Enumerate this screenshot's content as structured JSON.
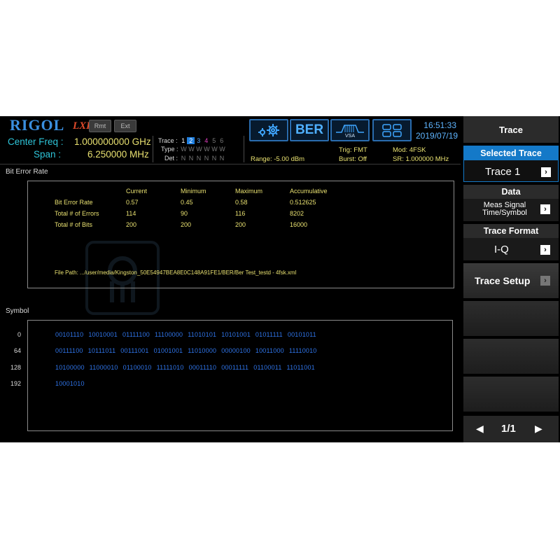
{
  "header": {
    "brand": "RIGOL",
    "lxi": "LXI",
    "rmt_label": "Rmt",
    "ext_label": "Ext",
    "center_freq_label": "Center Freq :",
    "center_freq_value": "1.000000000 GHz",
    "span_label": "Span :",
    "span_value": "6.250000 MHz",
    "trace_label": "Trace :",
    "type_label": "Type :",
    "det_label": "Det :",
    "trace_numbers": [
      "1",
      "2",
      "3",
      "4",
      "5",
      "6"
    ],
    "type_values": [
      "W",
      "W",
      "W",
      "W",
      "W",
      "W"
    ],
    "det_values": [
      "N",
      "N",
      "N",
      "N",
      "N",
      "N"
    ],
    "range": "Range: -5.00 dBm",
    "trig": "Trig: FMT",
    "burst": "Burst: Off",
    "mod": "Mod: 4FSK",
    "sr": "SR: 1.000000 MHz",
    "ber_label": "BER",
    "vsa_label": "VSA",
    "time": "16:51:33",
    "date": "2019/07/19",
    "icons": [
      "gear-icon",
      "vsa-spectrum-icon",
      "layout-grid-icon"
    ]
  },
  "ber_panel": {
    "title": "Bit Error Rate",
    "columns": [
      "Current",
      "Minimum",
      "Maximum",
      "Accumulative"
    ],
    "rows": [
      {
        "label": "Bit Error Rate",
        "values": [
          "0.57",
          "0.45",
          "0.58",
          "0.512625"
        ]
      },
      {
        "label": "Total # of Errors",
        "values": [
          "114",
          "90",
          "116",
          "8202"
        ]
      },
      {
        "label": "Total # of Bits",
        "values": [
          "200",
          "200",
          "200",
          "16000"
        ]
      }
    ],
    "file_path": "File Path: .../user/media/Kingston_50E54947BEA8E0C148A91FE1/BER/Ber Test_testd - 4fsk.xml"
  },
  "symbol_panel": {
    "title": "Symbol",
    "rows": [
      {
        "addr": "0",
        "groups": [
          "00101110",
          "10010001",
          "01111100",
          "11100000",
          "11010101",
          "10101001",
          "01011111",
          "00101011"
        ]
      },
      {
        "addr": "64",
        "groups": [
          "00111100",
          "10111011",
          "00111001",
          "01001001",
          "11010000",
          "00000100",
          "10011000",
          "11110010"
        ]
      },
      {
        "addr": "128",
        "groups": [
          "10100000",
          "11000010",
          "01100010",
          "11111010",
          "00011110",
          "00011111",
          "01100011",
          "11011001"
        ]
      },
      {
        "addr": "192",
        "groups": [
          "10001010"
        ]
      }
    ]
  },
  "softkeys": {
    "menu_title": "Trace",
    "selected_trace_label": "Selected Trace",
    "selected_trace_value": "Trace 1",
    "data_label": "Data",
    "data_value_line1": "Meas Signal",
    "data_value_line2": "Time/Symbol",
    "trace_format_label": "Trace Format",
    "trace_format_value": "I-Q",
    "trace_setup_label": "Trace Setup",
    "page_indicator": "1/1"
  },
  "colors": {
    "accent_blue": "#1479c8",
    "label_cyan": "#2ec4d8",
    "value_yellow": "#e8e070",
    "symbol_blue": "#2f74e8"
  }
}
